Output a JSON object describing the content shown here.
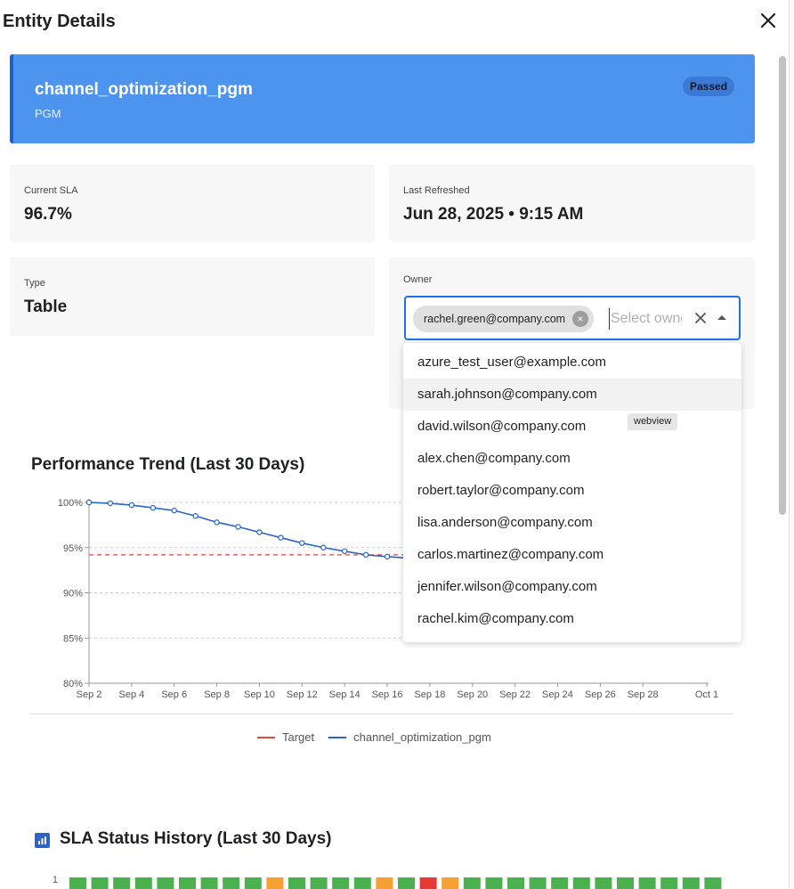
{
  "dialog": {
    "title": "Entity Details"
  },
  "hero": {
    "name": "channel_optimization_pgm",
    "subtitle": "PGM",
    "status": "Passed"
  },
  "stats": {
    "sla_label": "Current SLA",
    "sla_value": "96.7%",
    "refreshed_label": "Last Refreshed",
    "refreshed_value": "Jun 28, 2025 • 9:15 AM",
    "type_label": "Type",
    "type_value": "Table",
    "owner_label": "Owner"
  },
  "owner": {
    "selected": "rachel.green@company.com",
    "placeholder": "Select owner",
    "options": [
      "azure_test_user@example.com",
      "sarah.johnson@company.com",
      "david.wilson@company.com",
      "alex.chen@company.com",
      "robert.taylor@company.com",
      "lisa.anderson@company.com",
      "carlos.martinez@company.com",
      "jennifer.wilson@company.com",
      "rachel.kim@company.com"
    ],
    "highlighted_index": 1,
    "tooltip": "webview"
  },
  "colors": {
    "accent": "#4d94ee",
    "target": "#e04a3a",
    "series": "#2b63c6",
    "passed": "#4caf50",
    "warning": "#f5a030",
    "failed": "#e53935"
  },
  "chart_data": {
    "type": "line",
    "title": "Performance Trend (Last 30 Days)",
    "xlabel": "",
    "ylabel": "",
    "x_tick_labels": [
      "Sep 2",
      "Sep 4",
      "Sep 6",
      "Sep 8",
      "Sep 10",
      "Sep 12",
      "Sep 14",
      "Sep 16",
      "Sep 18",
      "Sep 20",
      "Sep 22",
      "Sep 24",
      "Sep 26",
      "Sep 28",
      "Oct 1"
    ],
    "y_tick_labels": [
      "100%",
      "95%",
      "90%",
      "85%",
      "80%"
    ],
    "ylim": [
      80,
      100
    ],
    "x": [
      "Sep 2",
      "Sep 3",
      "Sep 4",
      "Sep 5",
      "Sep 6",
      "Sep 7",
      "Sep 8",
      "Sep 9",
      "Sep 10",
      "Sep 11",
      "Sep 12",
      "Sep 13",
      "Sep 14",
      "Sep 15",
      "Sep 16"
    ],
    "series": [
      {
        "name": "Target",
        "values": [
          94.2,
          94.2,
          94.2,
          94.2,
          94.2,
          94.2,
          94.2,
          94.2,
          94.2,
          94.2,
          94.2,
          94.2,
          94.2,
          94.2,
          94.2
        ]
      },
      {
        "name": "channel_optimization_pgm",
        "values": [
          100,
          99.9,
          99.7,
          99.4,
          99.1,
          98.5,
          97.8,
          97.3,
          96.7,
          96.1,
          95.5,
          95.0,
          94.6,
          94.2,
          94.0
        ]
      }
    ],
    "grid": true,
    "legend": "bottom"
  },
  "history": {
    "title": "SLA Status History (Last 30 Days)",
    "y_label": "1",
    "statuses": [
      "passed",
      "passed",
      "passed",
      "passed",
      "passed",
      "passed",
      "passed",
      "passed",
      "passed",
      "warning",
      "passed",
      "passed",
      "passed",
      "passed",
      "warning",
      "passed",
      "failed",
      "warning",
      "passed",
      "passed",
      "passed",
      "passed",
      "passed",
      "passed",
      "passed",
      "passed",
      "passed",
      "passed",
      "passed",
      "passed"
    ]
  }
}
